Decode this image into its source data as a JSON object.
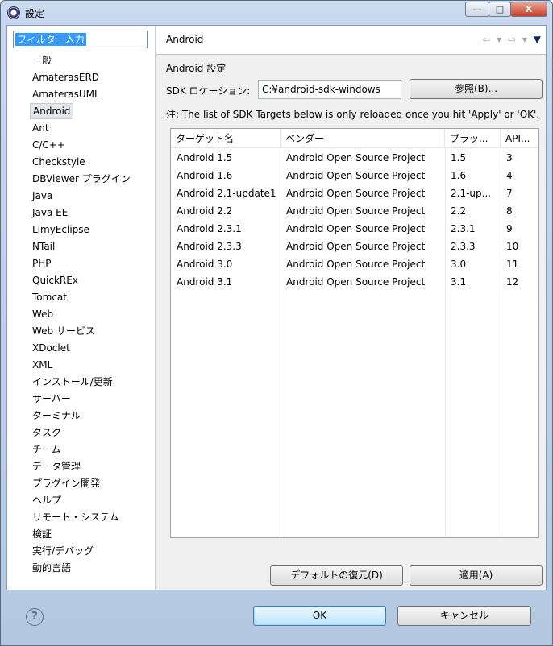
{
  "window": {
    "title": "設定",
    "controls": {
      "minimize": "—",
      "maximize": "□",
      "close": "X"
    }
  },
  "filter": {
    "value": "フィルター入力"
  },
  "tree": {
    "items": [
      "一般",
      "AmaterasERD",
      "AmaterasUML",
      "Android",
      "Ant",
      "C/C++",
      "Checkstyle",
      "DBViewer プラグイン",
      "Java",
      "Java EE",
      "LimyEclipse",
      "NTail",
      "PHP",
      "QuickREx",
      "Tomcat",
      "Web",
      "Web サービス",
      "XDoclet",
      "XML",
      "インストール/更新",
      "サーバー",
      "ターミナル",
      "タスク",
      "チーム",
      "データ管理",
      "プラグイン開発",
      "ヘルプ",
      "リモート・システム",
      "検証",
      "実行/デバッグ",
      "動的言語"
    ],
    "selected": "Android"
  },
  "page": {
    "title": "Android",
    "nav": {
      "back": "⇦",
      "back_menu": "▾",
      "forward": "⇨",
      "forward_menu": "▾",
      "view_menu": "▼"
    },
    "section_title": "Android 設定",
    "sdk_label": "SDK ロケーション:",
    "sdk_value": "C:¥android-sdk-windows",
    "browse_button": "参照(B)...",
    "note": "注: The list of SDK Targets below is only reloaded once you hit 'Apply' or 'OK'.",
    "table": {
      "headers": [
        "ターゲット名",
        "ベンダー",
        "プラッ...",
        "API..."
      ],
      "rows": [
        [
          "Android 1.5",
          "Android Open Source Project",
          "1.5",
          "3"
        ],
        [
          "Android 1.6",
          "Android Open Source Project",
          "1.6",
          "4"
        ],
        [
          "Android 2.1-update1",
          "Android Open Source Project",
          "2.1-up...",
          "7"
        ],
        [
          "Android 2.2",
          "Android Open Source Project",
          "2.2",
          "8"
        ],
        [
          "Android 2.3.1",
          "Android Open Source Project",
          "2.3.1",
          "9"
        ],
        [
          "Android 2.3.3",
          "Android Open Source Project",
          "2.3.3",
          "10"
        ],
        [
          "Android 3.0",
          "Android Open Source Project",
          "3.0",
          "11"
        ],
        [
          "Android 3.1",
          "Android Open Source Project",
          "3.1",
          "12"
        ]
      ]
    },
    "restore_defaults_button": "デフォルトの復元(D)",
    "apply_button": "適用(A)"
  },
  "footer": {
    "help_icon": "?",
    "ok_button": "OK",
    "cancel_button": "キャンセル"
  }
}
